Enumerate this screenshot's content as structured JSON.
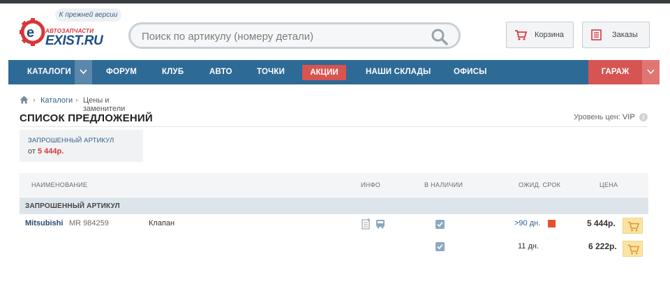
{
  "header": {
    "prev_version": "К прежней версии",
    "logo_sub": "АВТОЗАПЧАСТИ",
    "logo_text": "EXIST.RU",
    "search_placeholder": "Поиск по артикулу (номеру детали)",
    "cart_label": "Корзина",
    "orders_label": "Заказы"
  },
  "nav": {
    "catalogs": "КАТАЛОГИ",
    "forum": "ФОРУМ",
    "club": "КЛУБ",
    "auto": "АВТО",
    "points": "ТОЧКИ",
    "promo": "АКЦИИ",
    "warehouses": "НАШИ СКЛАДЫ",
    "offices": "ОФИСЫ",
    "garage": "ГАРАЖ"
  },
  "breadcrumb": {
    "sep": "›",
    "catalogs": "Каталоги",
    "current": "Цены и заменители"
  },
  "page": {
    "title": "СПИСОК ПРЕДЛОЖЕНИЙ",
    "price_level_label": "Уровень цен:",
    "price_level_value": "VIP",
    "info_glyph": "i"
  },
  "requested": {
    "label": "ЗАПРОШЕННЫЙ АРТИКУЛ",
    "from": "от",
    "price": "5 444р."
  },
  "table": {
    "columns": {
      "name": "НАИМЕНОВАНИЕ",
      "info": "ИНФО",
      "stock": "В НАЛИЧИИ",
      "term": "ОЖИД. СРОК",
      "price": "ЦЕНА"
    },
    "group": "ЗАПРОШЕННЫЙ АРТИКУЛ",
    "rows": [
      {
        "brand": "Mitsubishi",
        "article": "MR 984259",
        "name": "Клапан",
        "in_stock": true,
        "term": ">90 дн.",
        "price": "5 444р."
      },
      {
        "brand": "",
        "article": "",
        "name": "",
        "in_stock": true,
        "term": "11 дн.",
        "price": "6 222р."
      }
    ]
  },
  "colors": {
    "nav_bg": "#2e6a96",
    "promo": "#d9534f",
    "garage": "#d65553",
    "accent_price": "#d9363e",
    "term_flag": "#e2542b",
    "buy_button": "#f9e4a4"
  }
}
